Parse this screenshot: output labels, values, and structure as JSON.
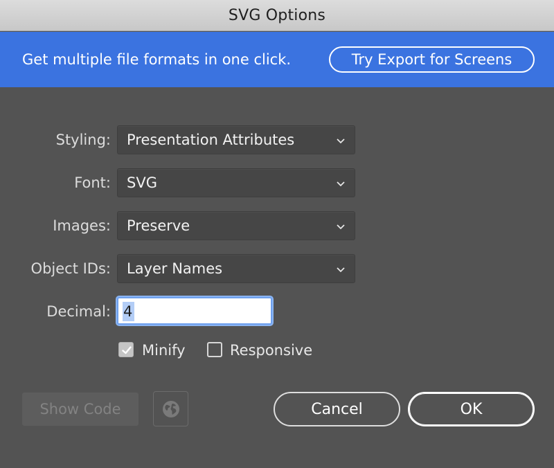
{
  "window": {
    "title": "SVG Options"
  },
  "banner": {
    "message": "Get multiple file formats in one click.",
    "button_label": "Try Export for Screens"
  },
  "fields": {
    "styling": {
      "label": "Styling:",
      "value": "Presentation Attributes"
    },
    "font": {
      "label": "Font:",
      "value": "SVG"
    },
    "images": {
      "label": "Images:",
      "value": "Preserve"
    },
    "object_ids": {
      "label": "Object IDs:",
      "value": "Layer Names"
    },
    "decimal": {
      "label": "Decimal:",
      "value": "4"
    }
  },
  "options": {
    "minify": {
      "label": "Minify",
      "checked": true
    },
    "responsive": {
      "label": "Responsive",
      "checked": false
    }
  },
  "footer": {
    "show_code_label": "Show Code",
    "globe_icon": "globe-icon",
    "cancel_label": "Cancel",
    "ok_label": "OK"
  },
  "colors": {
    "banner": "#3b73e0",
    "dialog_bg": "#535353"
  }
}
